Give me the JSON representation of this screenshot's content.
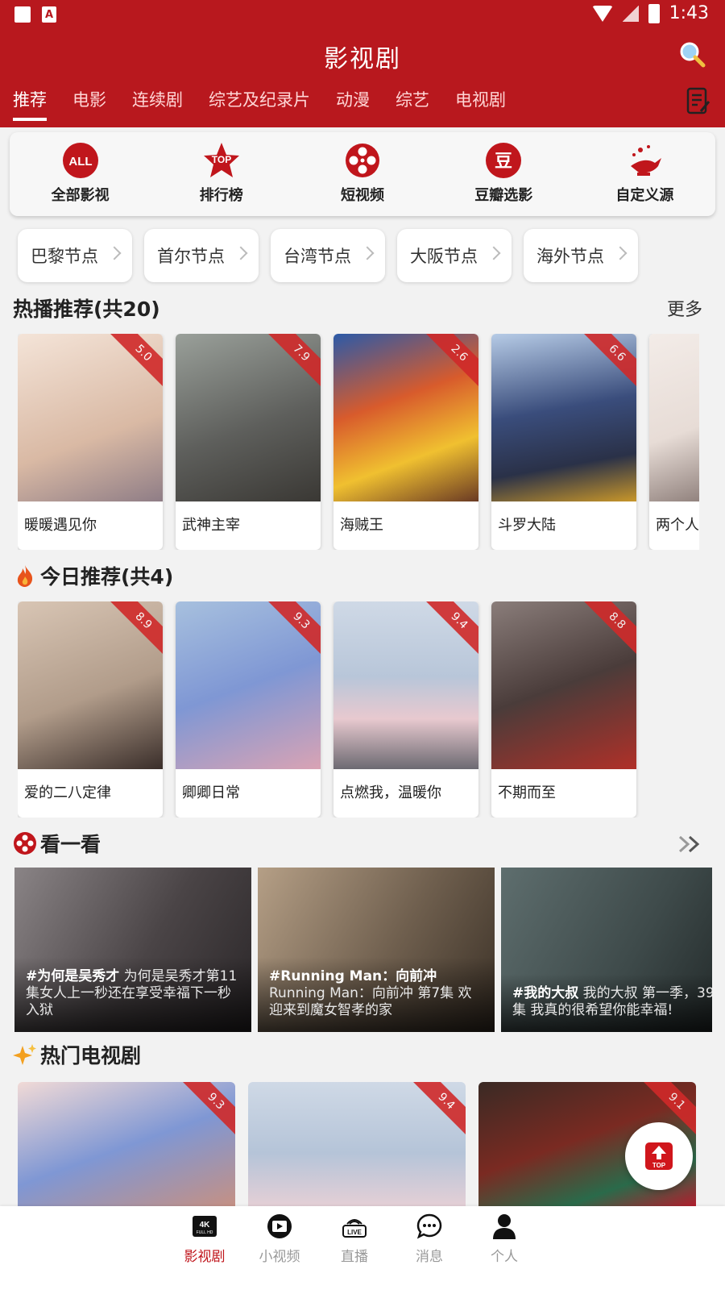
{
  "status": {
    "time": "1:43"
  },
  "header": {
    "title": "影视剧",
    "tabs": [
      "推荐",
      "电影",
      "连续剧",
      "综艺及纪录片",
      "动漫",
      "综艺",
      "电视剧"
    ]
  },
  "shortcuts": [
    {
      "label": "全部影视",
      "icon": "all-icon"
    },
    {
      "label": "排行榜",
      "icon": "top-ranking-icon"
    },
    {
      "label": "短视频",
      "icon": "film-reel-icon"
    },
    {
      "label": "豆瓣选影",
      "icon": "douban-icon"
    },
    {
      "label": "自定义源",
      "icon": "magic-lamp-icon"
    }
  ],
  "nodes": [
    "巴黎节点",
    "首尔节点",
    "台湾节点",
    "大阪节点",
    "海外节点"
  ],
  "hot": {
    "title": "热播推荐(共20)",
    "more": "更多",
    "items": [
      {
        "title": "暖暖遇见你",
        "score": "5.0",
        "bg": "#e9d5c8"
      },
      {
        "title": "武神主宰",
        "score": "7.9",
        "bg": "#6e6f6c"
      },
      {
        "title": "海贼王",
        "score": "2.6",
        "bg": "#d85b2c"
      },
      {
        "title": "斗罗大陆",
        "score": "6.6",
        "bg": "#3a4d7c"
      },
      {
        "title": "两个人的",
        "score": "",
        "bg": "#e7dcd6"
      }
    ]
  },
  "today": {
    "title": "今日推荐(共4)",
    "items": [
      {
        "title": "爱的二八定律",
        "score": "8.9",
        "bg": "#c9b7a7"
      },
      {
        "title": "卿卿日常",
        "score": "9.3",
        "bg": "#8fa6c9"
      },
      {
        "title": "点燃我，温暖你",
        "score": "9.4",
        "bg": "#b8c6d9"
      },
      {
        "title": "不期而至",
        "score": "8.8",
        "bg": "#6b5a56"
      }
    ]
  },
  "watch": {
    "title": "看一看",
    "videos": [
      {
        "tag": "#为何是吴秀才",
        "desc": "为何是吴秀才第11集女人上一秒还在享受幸福下一秒入狱",
        "bg": "#5a5456"
      },
      {
        "tag": "#Running Man：向前冲",
        "desc": "Running Man：向前冲 第7集 欢迎来到魔女智孝的家",
        "bg": "#6f5f4e"
      },
      {
        "tag": "#我的大叔",
        "desc": "我的大叔 第一季，39集 我真的很希望你能幸福!",
        "bg": "#3e4a4a"
      }
    ]
  },
  "tv": {
    "title": "热门电视剧",
    "items": [
      {
        "score": "9.3",
        "bg": "#7f97d4"
      },
      {
        "score": "9.4",
        "bg": "#b5c4d8"
      },
      {
        "score": "9.1",
        "bg": "#7a2a22"
      }
    ]
  },
  "top_button": "TOP",
  "bottom_nav": [
    {
      "label": "影视剧",
      "icon": "4k-icon",
      "active": true
    },
    {
      "label": "小视频",
      "icon": "play-icon",
      "active": false
    },
    {
      "label": "直播",
      "icon": "live-icon",
      "active": false
    },
    {
      "label": "消息",
      "icon": "chat-icon",
      "active": false
    },
    {
      "label": "个人",
      "icon": "person-icon",
      "active": false
    }
  ],
  "colors": {
    "brand": "#b8181e",
    "accent": "#d02a2a"
  }
}
